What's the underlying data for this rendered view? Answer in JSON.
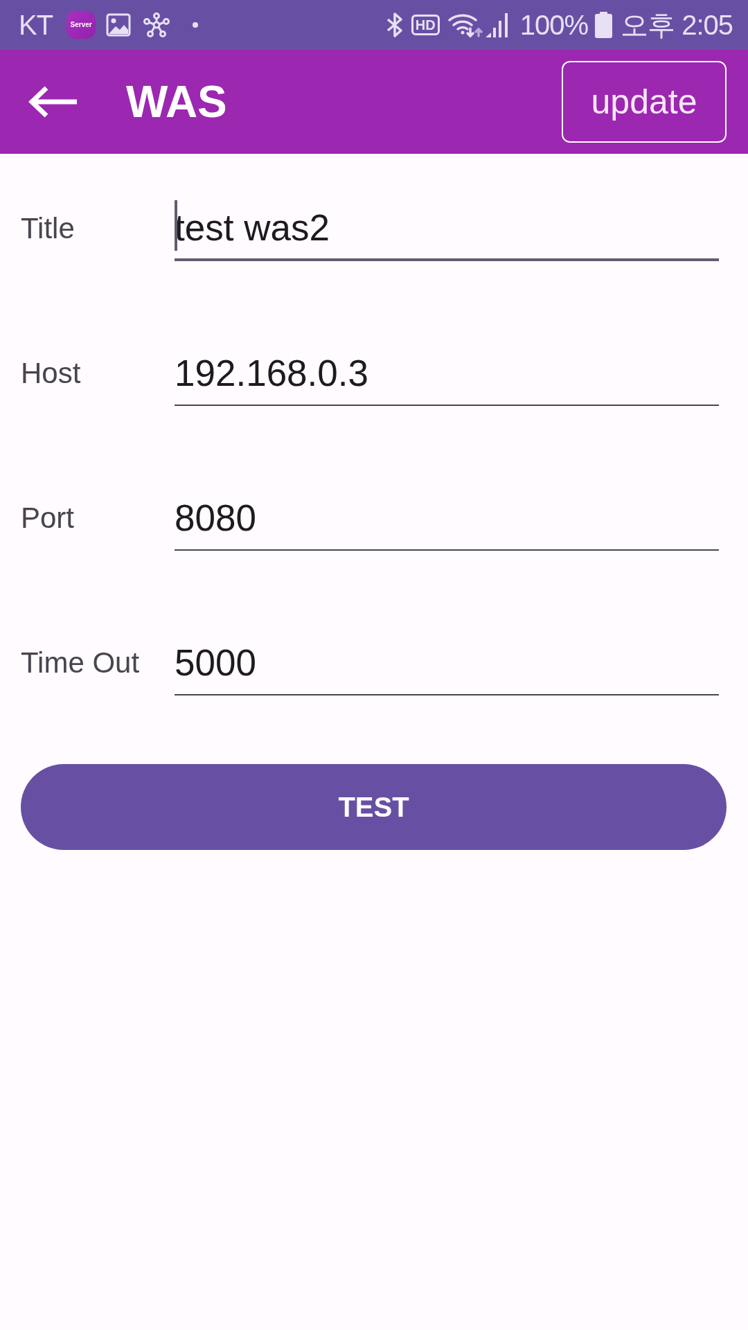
{
  "status_bar": {
    "carrier": "KT",
    "app_badge": "Server",
    "hd_badge": "HD",
    "battery_percent": "100%",
    "time": "오후 2:05"
  },
  "app_bar": {
    "title": "WAS",
    "action": "update"
  },
  "fields": [
    {
      "label": "Title",
      "value": "test was2",
      "focused": true
    },
    {
      "label": "Host",
      "value": "192.168.0.3",
      "focused": false
    },
    {
      "label": "Port",
      "value": "8080",
      "focused": false
    },
    {
      "label": "Time Out",
      "value": "5000",
      "focused": false
    }
  ],
  "test_button": "TEST"
}
